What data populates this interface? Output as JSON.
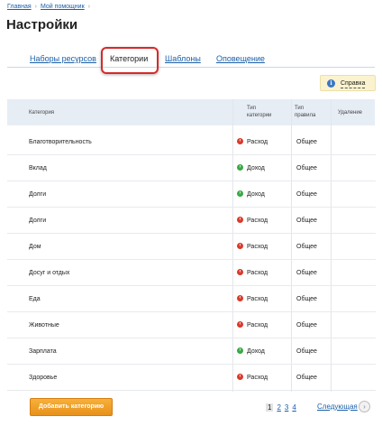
{
  "breadcrumb": {
    "home": "Главная",
    "current": "Мой помощник"
  },
  "page_title": "Настройки",
  "tabs": [
    "Наборы ресурсов",
    "Категории",
    "Шаблоны",
    "Оповещение"
  ],
  "active_tab": "Категории",
  "help_button": "Справка",
  "table": {
    "headers": {
      "category": "Категория",
      "type": "Тип категории",
      "rule": "Тип правила",
      "delete": "Удаление"
    },
    "rows": [
      {
        "name": "Благотворительность",
        "type": "Расход",
        "type_kind": "expense",
        "rule": "Общее"
      },
      {
        "name": "Вклад",
        "type": "Доход",
        "type_kind": "income",
        "rule": "Общее"
      },
      {
        "name": "Долги",
        "type": "Доход",
        "type_kind": "income",
        "rule": "Общее"
      },
      {
        "name": "Долги",
        "type": "Расход",
        "type_kind": "expense",
        "rule": "Общее"
      },
      {
        "name": "Дом",
        "type": "Расход",
        "type_kind": "expense",
        "rule": "Общее"
      },
      {
        "name": "Досуг и отдых",
        "type": "Расход",
        "type_kind": "expense",
        "rule": "Общее"
      },
      {
        "name": "Еда",
        "type": "Расход",
        "type_kind": "expense",
        "rule": "Общее"
      },
      {
        "name": "Животные",
        "type": "Расход",
        "type_kind": "expense",
        "rule": "Общее"
      },
      {
        "name": "Зарплата",
        "type": "Доход",
        "type_kind": "income",
        "rule": "Общее"
      },
      {
        "name": "Здоровье",
        "type": "Расход",
        "type_kind": "expense",
        "rule": "Общее"
      }
    ]
  },
  "add_button": "Добавить категорию",
  "pagination": {
    "pages": [
      "1",
      "2",
      "3",
      "4"
    ],
    "current": "1",
    "next": "Следующая"
  },
  "colors": {
    "expense": "#d93a2b",
    "income": "#39a845",
    "link": "#1a5fa8",
    "add_button": "#f0a02a"
  }
}
